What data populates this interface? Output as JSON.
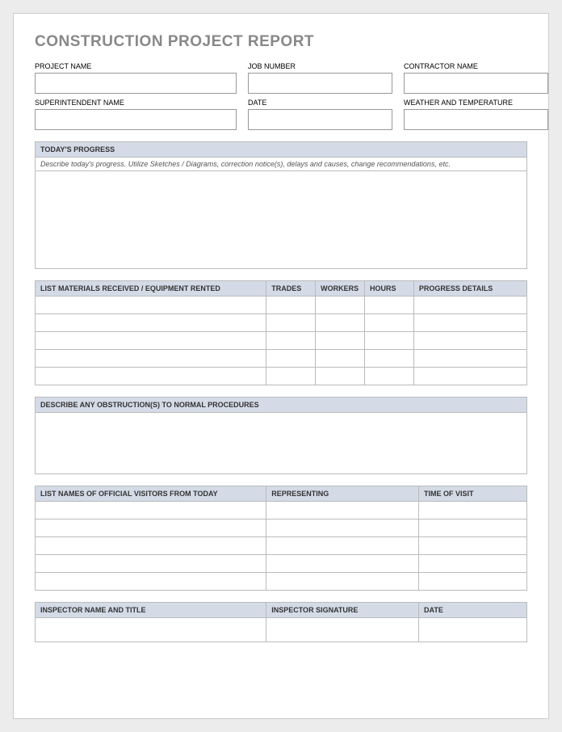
{
  "title": "CONSTRUCTION PROJECT REPORT",
  "fields": {
    "project_name": {
      "label": "PROJECT NAME",
      "value": ""
    },
    "job_number": {
      "label": "JOB NUMBER",
      "value": ""
    },
    "contractor_name": {
      "label": "CONTRACTOR NAME",
      "value": ""
    },
    "superintendent_name": {
      "label": "SUPERINTENDENT NAME",
      "value": ""
    },
    "date": {
      "label": "DATE",
      "value": ""
    },
    "weather": {
      "label": "WEATHER AND TEMPERATURE",
      "value": ""
    }
  },
  "progress_section": {
    "header": "TODAY'S PROGRESS",
    "instructions": "Describe today's progress.  Utilize Sketches / Diagrams, correction notice(s), delays and causes, change recommendations, etc.",
    "value": ""
  },
  "materials_table": {
    "headers": [
      "LIST MATERIALS RECEIVED / EQUIPMENT RENTED",
      "TRADES",
      "WORKERS",
      "HOURS",
      "PROGRESS DETAILS"
    ],
    "rows": [
      [
        "",
        "",
        "",
        "",
        ""
      ],
      [
        "",
        "",
        "",
        "",
        ""
      ],
      [
        "",
        "",
        "",
        "",
        ""
      ],
      [
        "",
        "",
        "",
        "",
        ""
      ],
      [
        "",
        "",
        "",
        "",
        ""
      ]
    ]
  },
  "obstruction_section": {
    "header": "DESCRIBE ANY OBSTRUCTION(S) TO NORMAL PROCEDURES",
    "value": ""
  },
  "visitors_table": {
    "headers": [
      "LIST NAMES OF OFFICIAL VISITORS FROM TODAY",
      "REPRESENTING",
      "TIME OF VISIT"
    ],
    "rows": [
      [
        "",
        "",
        ""
      ],
      [
        "",
        "",
        ""
      ],
      [
        "",
        "",
        ""
      ],
      [
        "",
        "",
        ""
      ],
      [
        "",
        "",
        ""
      ]
    ]
  },
  "inspector_table": {
    "headers": [
      "INSPECTOR NAME AND TITLE",
      "INSPECTOR SIGNATURE",
      "DATE"
    ],
    "rows": [
      [
        "",
        "",
        ""
      ]
    ]
  }
}
